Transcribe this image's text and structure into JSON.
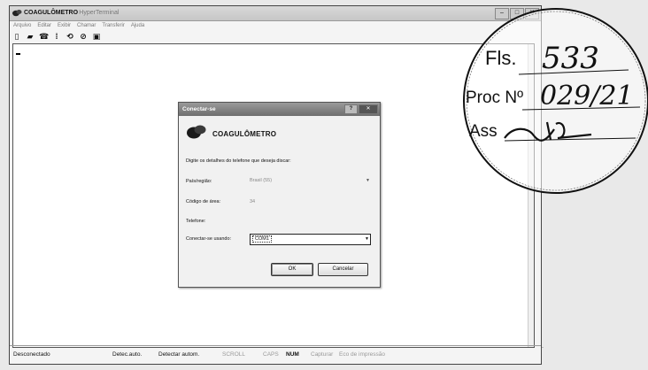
{
  "window": {
    "app_name": "COAGULÔMETRO",
    "title_rest": "- HyperTerminal"
  },
  "menu": [
    "Arquivo",
    "Editar",
    "Exibir",
    "Chamar",
    "Transferir",
    "Ajuda"
  ],
  "dialog": {
    "title": "Conectar-se",
    "heading": "COAGULÔMETRO",
    "instructions": "Digite os detalhes do telefone que deseja discar:",
    "country_label": "País/região:",
    "country_value": "Brasil (55)",
    "area_label": "Código de área:",
    "area_value": "34",
    "phone_label": "Telefone:",
    "connect_label": "Conectar-se usando:",
    "connect_value": "COM1",
    "ok_label": "OK",
    "cancel_label": "Cancelar"
  },
  "status": {
    "connection": "Desconectado",
    "detect1": "Detec.auto.",
    "detect2": "Detectar autom.",
    "scroll": "SCROLL",
    "caps": "CAPS",
    "num": "NUM",
    "capture": "Capturar",
    "echo": "Eco de impressão"
  },
  "stamp": {
    "fls_label": "Fls.",
    "fls_value": "533",
    "proc_label": "Proc Nº",
    "proc_value": "029/21",
    "ass_label": "Ass"
  }
}
